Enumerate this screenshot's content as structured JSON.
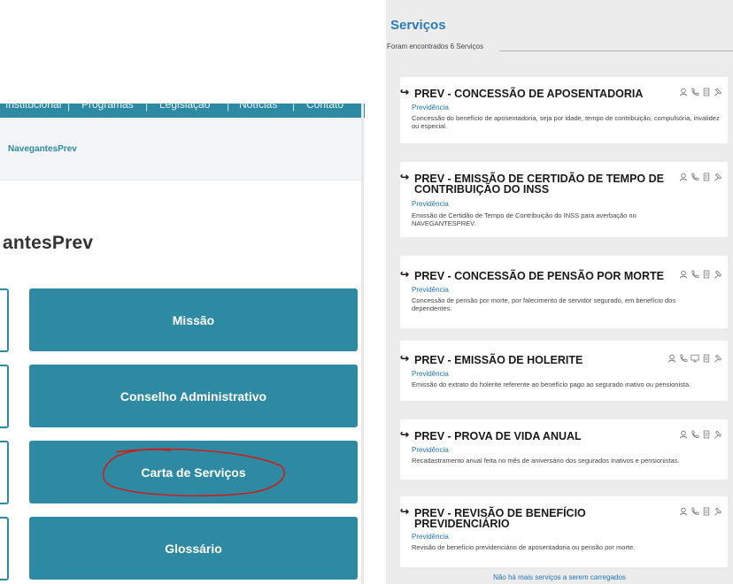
{
  "left_panel": {
    "nav": [
      "Institucional",
      "Programas",
      "Legislação",
      "Notícias",
      "Contato"
    ],
    "breadcrumb": "NavegantesPrev",
    "page_title": "antesPrev",
    "buttons": [
      "Missão",
      "Conselho Administrativo",
      "Carta de Serviços",
      "Glossário"
    ]
  },
  "right_panel": {
    "title": "Serviços",
    "count_text": "Foram encontrados 6 Serviços",
    "services": [
      {
        "title_line1": "PREV - CONCESSÃO DE APOSENTADORIA",
        "title_line2": "",
        "category": "Previdência",
        "description": "Concessão do benefício de aposentadoria, seja por idade, tempo de contribuição, compulsória, invalidez ou especial.",
        "icons": [
          "person-icon",
          "phone-icon",
          "document-icon",
          "hammer-icon"
        ]
      },
      {
        "title_line1": "PREV - EMISSÃO DE CERTIDÃO DE TEMPO DE",
        "title_line2": "CONTRIBUIÇÃO DO INSS",
        "category": "Previdência",
        "description": "Emissão de Certidão de Tempo de Contribuição do INSS para averbação no NAVEGANTESPREV.",
        "icons": [
          "person-icon",
          "phone-icon",
          "document-icon",
          "hammer-icon"
        ]
      },
      {
        "title_line1": "PREV - CONCESSÃO DE PENSÃO POR MORTE",
        "title_line2": "",
        "category": "Previdência",
        "description": "Concessão de pensão por morte, por falecimento de servidor segurado, em benefício dos dependentes.",
        "icons": [
          "person-icon",
          "phone-icon",
          "document-icon",
          "hammer-icon"
        ]
      },
      {
        "title_line1": "PREV - EMISSÃO DE HOLERITE",
        "title_line2": "",
        "category": "Previdência",
        "description": "Emissão do extrato do holerite referente ao benefício pago ao segurado inativo ou pensionista.",
        "icons": [
          "person-icon",
          "phone-icon",
          "monitor-icon",
          "document-icon",
          "hammer-icon"
        ]
      },
      {
        "title_line1": "PREV - PROVA DE VIDA ANUAL",
        "title_line2": "",
        "category": "Previdência",
        "description": "Recadastramento anual feita no mês de aniversário dos segurados inativos e pensionistas.",
        "icons": [
          "person-icon",
          "phone-icon",
          "document-icon",
          "hammer-icon"
        ]
      },
      {
        "title_line1": "PREV - REVISÃO DE BENEFÍCIO",
        "title_line2": "PREVIDENCIÁRIO",
        "category": "Previdência",
        "description": "Revisão de benefício previdenciário de aposentadoria ou pensão por morte.",
        "icons": [
          "person-icon",
          "phone-icon",
          "document-icon",
          "hammer-icon"
        ]
      }
    ],
    "footer": "Não há mais serviços a serem carregados"
  },
  "colors": {
    "primary": "#2e8aa3",
    "link": "#1e73b6",
    "annotation": "#c8201e"
  }
}
